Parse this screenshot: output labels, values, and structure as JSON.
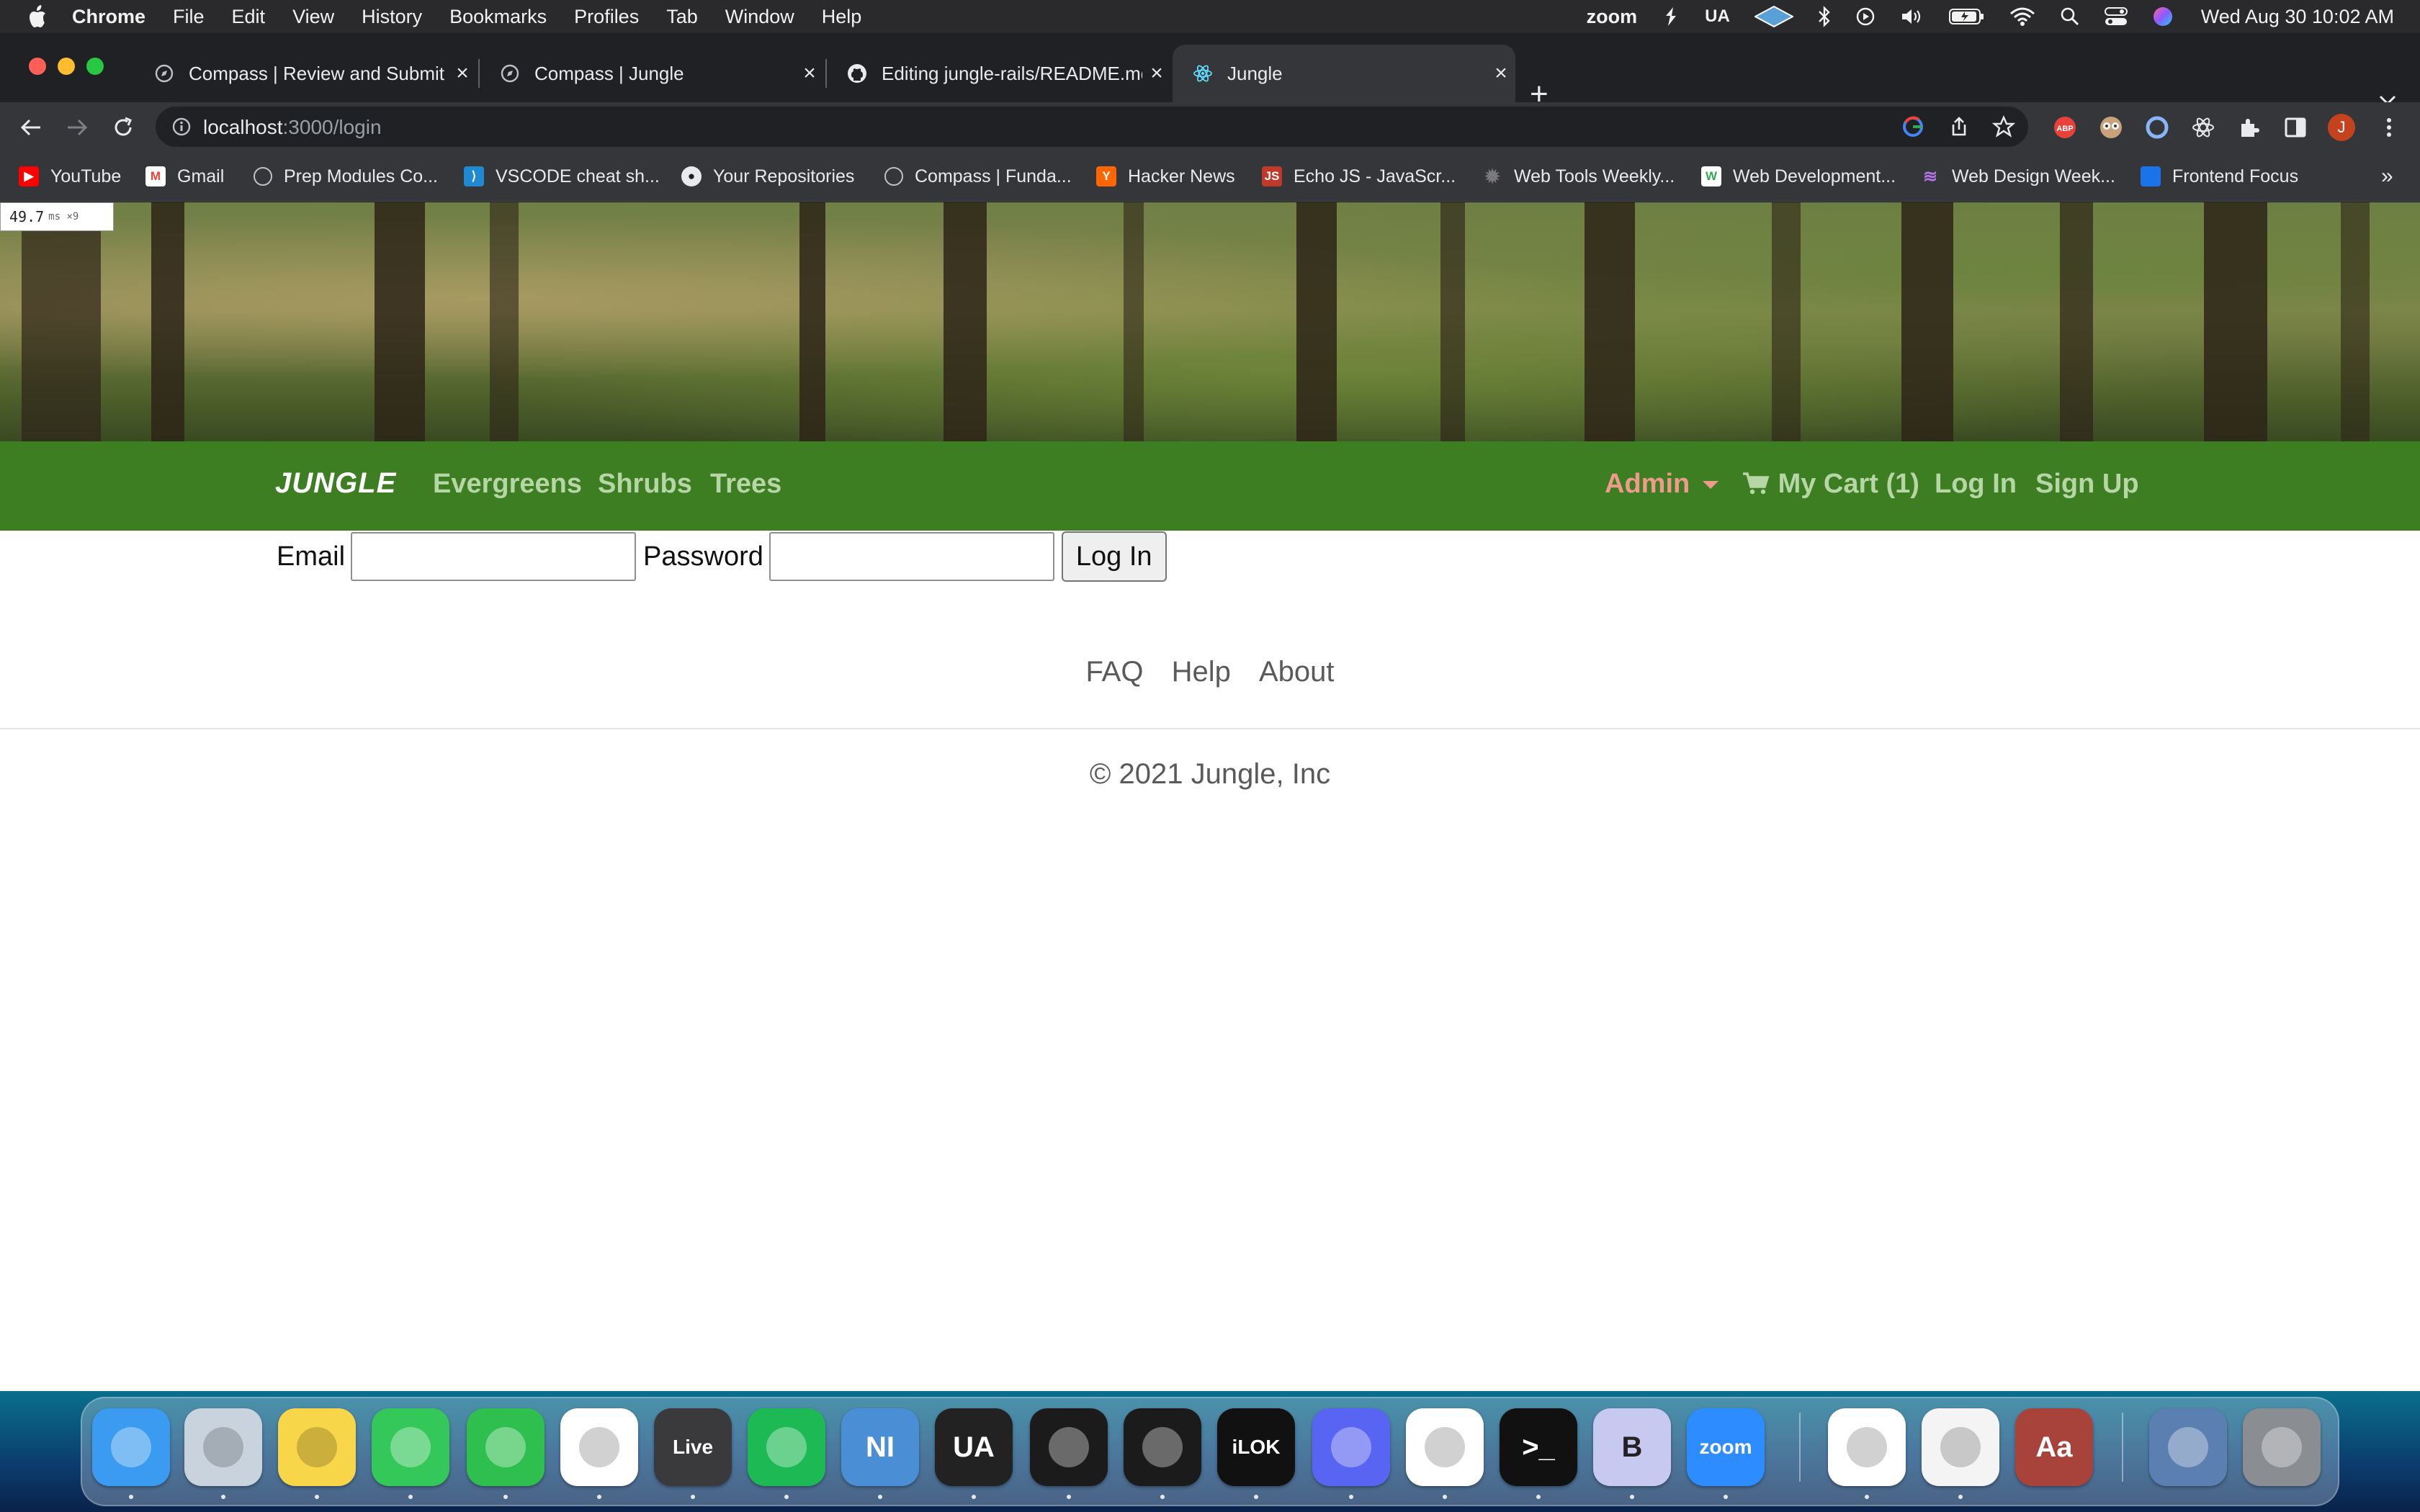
{
  "menubar": {
    "app_name": "Chrome",
    "items": [
      "File",
      "Edit",
      "View",
      "History",
      "Bookmarks",
      "Profiles",
      "Tab",
      "Window",
      "Help"
    ],
    "status": {
      "zoom_label": "zoom",
      "ua_label": "UA",
      "clock": "Wed Aug 30  10:02 AM"
    }
  },
  "browser": {
    "tabs": [
      {
        "title": "Compass | Review and Submit",
        "favicon": "compass-icon"
      },
      {
        "title": "Compass | Jungle",
        "favicon": "compass-icon"
      },
      {
        "title": "Editing jungle-rails/README.md",
        "favicon": "github-icon"
      },
      {
        "title": "Jungle",
        "favicon": "react-icon"
      }
    ],
    "new_tab_label": "+",
    "address": {
      "host": "localhost",
      "path": ":3000/login"
    },
    "profile_initial": "J",
    "bookmarks": [
      {
        "label": "YouTube",
        "icon": "youtube-icon",
        "color": "#ff0000"
      },
      {
        "label": "Gmail",
        "icon": "gmail-icon",
        "color": "#ea4335"
      },
      {
        "label": "Prep Modules Co...",
        "icon": "compass-icon",
        "color": "#5f6368"
      },
      {
        "label": "VSCODE cheat sh...",
        "icon": "vscode-icon",
        "color": "#1f8ad2"
      },
      {
        "label": "Your Repositories",
        "icon": "github-icon",
        "color": "#ffffff"
      },
      {
        "label": "Compass | Funda...",
        "icon": "compass-icon",
        "color": "#5f6368"
      },
      {
        "label": "Hacker News",
        "icon": "hackernews-icon",
        "color": "#ff6600"
      },
      {
        "label": "Echo JS - JavaScr...",
        "icon": "echojs-icon",
        "color": "#c0392b"
      },
      {
        "label": "Web Tools Weekly...",
        "icon": "gear-icon",
        "color": "#5a5a5a"
      },
      {
        "label": "Web Development...",
        "icon": "w-icon",
        "color": "#3aa757"
      },
      {
        "label": "Web Design Week...",
        "icon": "waves-icon",
        "color": "#8e44ad"
      },
      {
        "label": "Frontend Focus",
        "icon": "chat-icon",
        "color": "#1a73e8"
      }
    ],
    "overflow_label": "»"
  },
  "page": {
    "perf_badge": {
      "value": "49.7",
      "unit": "ms ×9"
    },
    "nav": {
      "brand": "JUNGLE",
      "categories": [
        "Evergreens",
        "Shrubs",
        "Trees"
      ],
      "admin": "Admin",
      "cart": "My Cart (1)",
      "login": "Log In",
      "signup": "Sign Up"
    },
    "login_form": {
      "email_label": "Email",
      "email_value": "",
      "password_label": "Password",
      "password_value": "",
      "submit_label": "Log In"
    },
    "footer": {
      "links": [
        "FAQ",
        "Help",
        "About"
      ],
      "copyright": "© 2021 Jungle, Inc"
    }
  },
  "dock": {
    "apps": [
      {
        "name": "Finder",
        "icon": "finder-icon",
        "label": "",
        "color": "#3b9bf0"
      },
      {
        "name": "Launchpad",
        "icon": "launchpad-icon",
        "label": "",
        "color": "#c9d3dd"
      },
      {
        "name": "Notes",
        "icon": "notes-icon",
        "label": "",
        "color": "#f7d64a"
      },
      {
        "name": "Messages",
        "icon": "messages-icon",
        "label": "",
        "color": "#34c759"
      },
      {
        "name": "FaceTime",
        "icon": "facetime-icon",
        "label": "",
        "color": "#2fbf4f"
      },
      {
        "name": "Chrome",
        "icon": "chrome-icon",
        "label": "",
        "color": "#ffffff"
      },
      {
        "name": "Ableton Live",
        "icon": "live-icon",
        "label": "Live",
        "color": "#3a3a3c"
      },
      {
        "name": "Spotify",
        "icon": "spotify-icon",
        "label": "",
        "color": "#1db954"
      },
      {
        "name": "Native Instruments",
        "icon": "ni-icon",
        "label": "NI",
        "color": "#4a8fd6"
      },
      {
        "name": "UA Connect",
        "icon": "ua-icon",
        "label": "UA",
        "color": "#222222"
      },
      {
        "name": "UAD Console",
        "icon": "uad-console-icon",
        "label": "",
        "color": "#1b1b1b"
      },
      {
        "name": "UAD Meter",
        "icon": "uad-meter-icon",
        "label": "",
        "color": "#1b1b1b"
      },
      {
        "name": "iLok",
        "icon": "ilok-icon",
        "label": "iLOK",
        "color": "#111111"
      },
      {
        "name": "Discord",
        "icon": "discord-icon",
        "label": "",
        "color": "#5865f2"
      },
      {
        "name": "VS Code",
        "icon": "vscode-icon",
        "label": "",
        "color": "#ffffff"
      },
      {
        "name": "Terminal",
        "icon": "terminal-icon",
        "label": ">_",
        "color": "#111111"
      },
      {
        "name": "BBEdit",
        "icon": "bbedit-icon",
        "label": "B",
        "color": "#c7c9f0"
      },
      {
        "name": "Zoom",
        "icon": "zoom-icon",
        "label": "zoom",
        "color": "#2d8cff"
      },
      {
        "name": "Splice",
        "icon": "splice-icon",
        "label": "",
        "color": "#ffffff"
      },
      {
        "name": "TextEdit",
        "icon": "textedit-icon",
        "label": "",
        "color": "#f4f4f4"
      },
      {
        "name": "Dictionary",
        "icon": "dictionary-icon",
        "label": "Aa",
        "color": "#a8433c"
      },
      {
        "name": "Downloads",
        "icon": "downloads-icon",
        "label": "",
        "color": "#5b7fb0"
      },
      {
        "name": "Trash",
        "icon": "trash-icon",
        "label": "",
        "color": "#8a8d92"
      }
    ]
  }
}
